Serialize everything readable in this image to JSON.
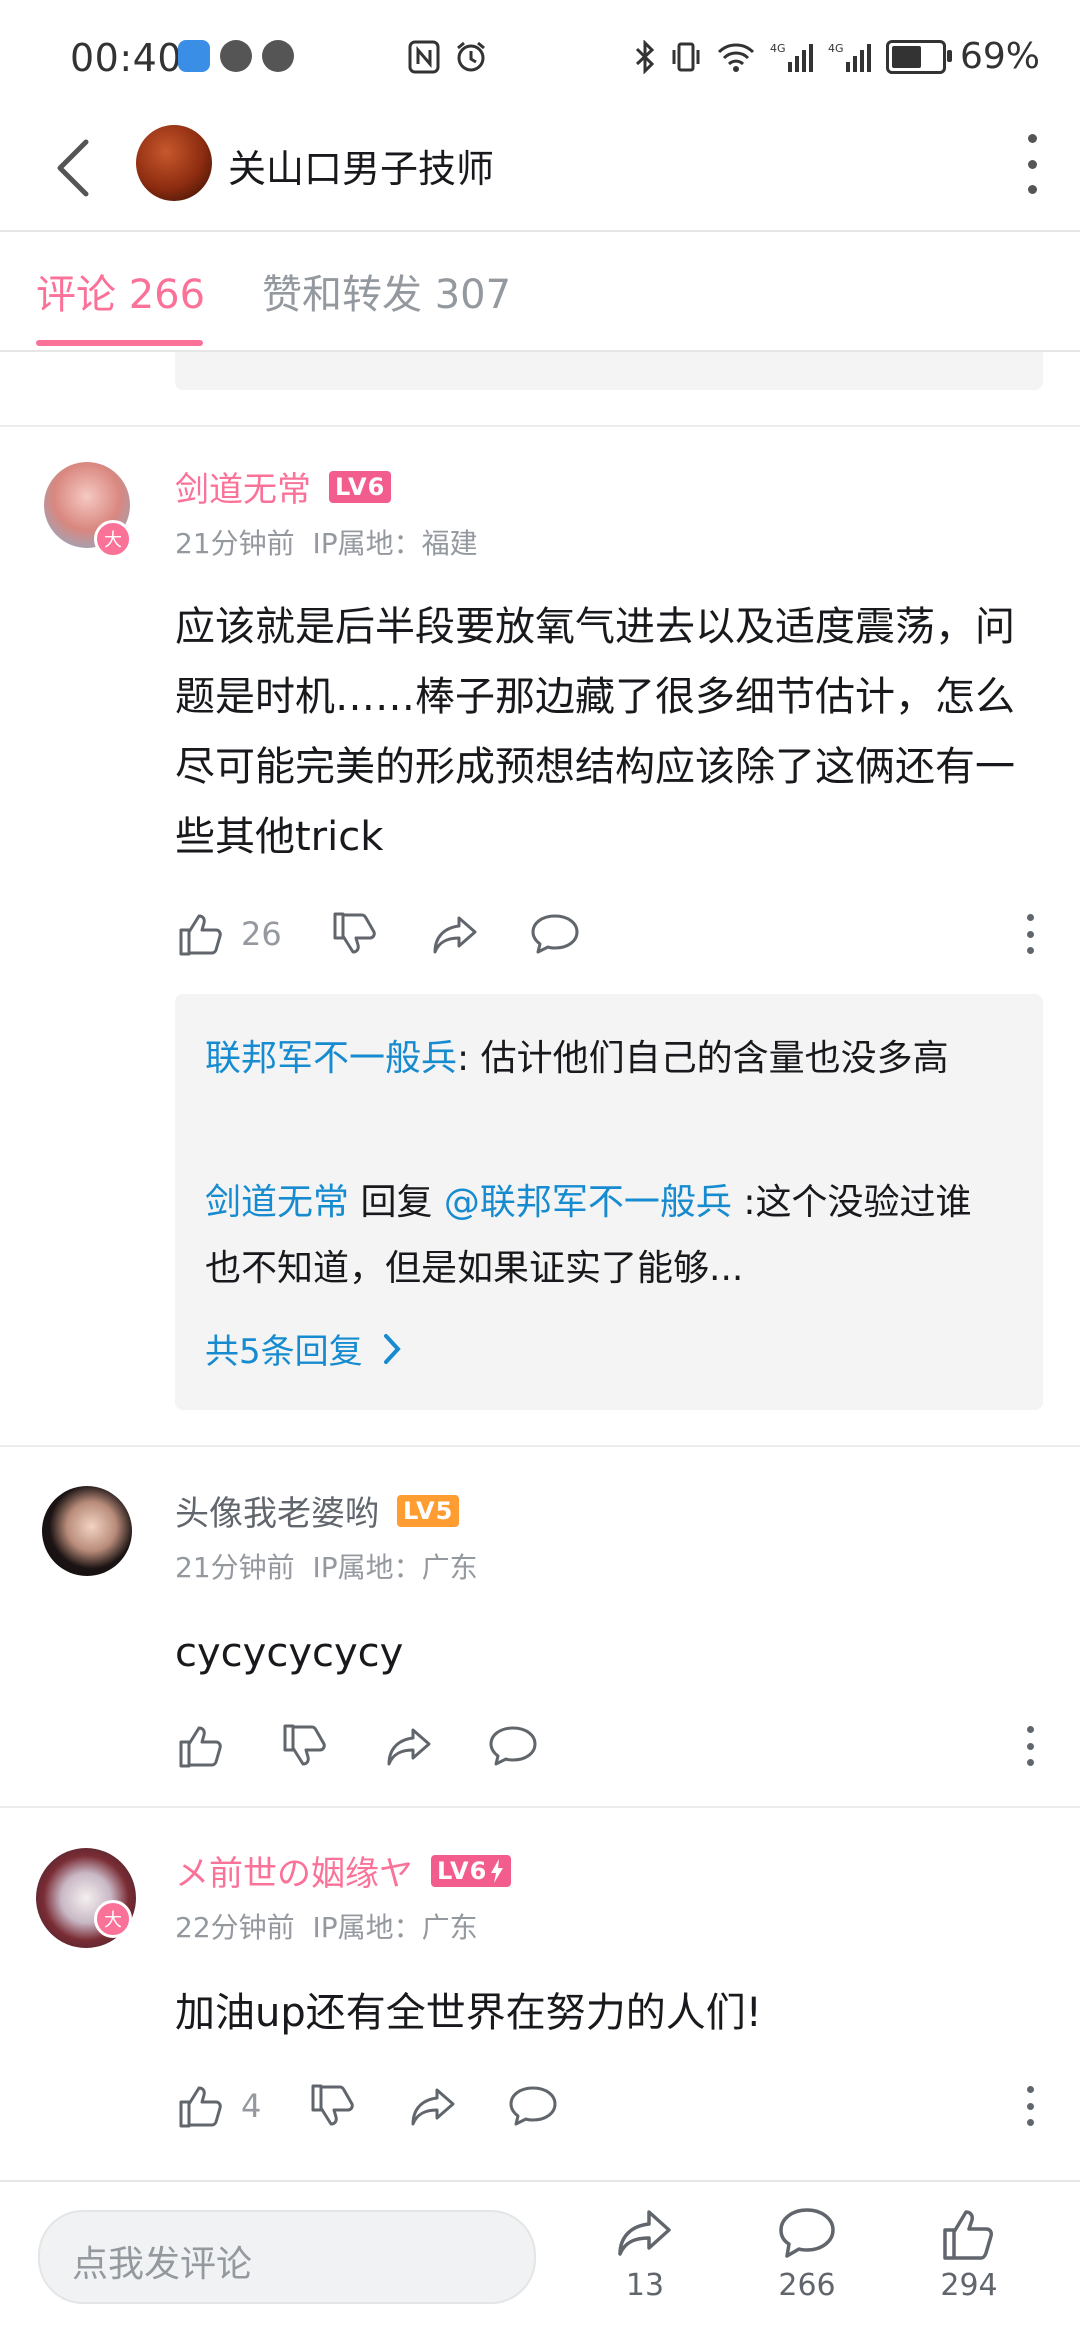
{
  "status_bar": {
    "time": "00:40",
    "battery": "69%",
    "battery_level": 0.69
  },
  "header": {
    "title": "关山口男子技师"
  },
  "tabs": [
    {
      "label": "评论 266",
      "active": true
    },
    {
      "label": "赞和转发 307",
      "active": false
    }
  ],
  "comments": [
    {
      "username": "剑道无常",
      "level": "LV6",
      "time": "21分钟前",
      "ip": "IP属地：福建",
      "content": "应该就是后半段要放氧气进去以及适度震荡，问题是时机……棒子那边藏了很多细节估计，怎么尽可能完美的形成预想结构应该除了这俩还有一些其他trick",
      "likes": "26",
      "badge": "大"
    },
    {
      "username": "头像我老婆哟",
      "level": "LV5",
      "time": "21分钟前",
      "ip": "IP属地：广东",
      "content": "cycycycycy",
      "likes": ""
    },
    {
      "username": "メ前世の姻缘ヤ",
      "level": "LV6",
      "time": "22分钟前",
      "ip": "IP属地：广东",
      "content": "加油up还有全世界在努力的人们!",
      "likes": "4",
      "badge": "大"
    }
  ],
  "replies": {
    "r1_user": "联邦军不一般兵",
    "r1_text": ": 估计他们自己的含量也没多高",
    "r2_user": "剑道无常",
    "r2_mid": " 回复 ",
    "r2_mention": "@联邦军不一般兵",
    "r2_text": " :这个没验过谁也不知道，但是如果证实了能够...",
    "more": "共5条回复"
  },
  "bottom_bar": {
    "placeholder": "点我发评论",
    "share_count": "13",
    "comment_count": "266",
    "like_count": "294"
  },
  "colors": {
    "accent": "#fb7299",
    "link": "#178bcf",
    "lv6": "#f25d8e",
    "lv5": "#ff9d33"
  }
}
